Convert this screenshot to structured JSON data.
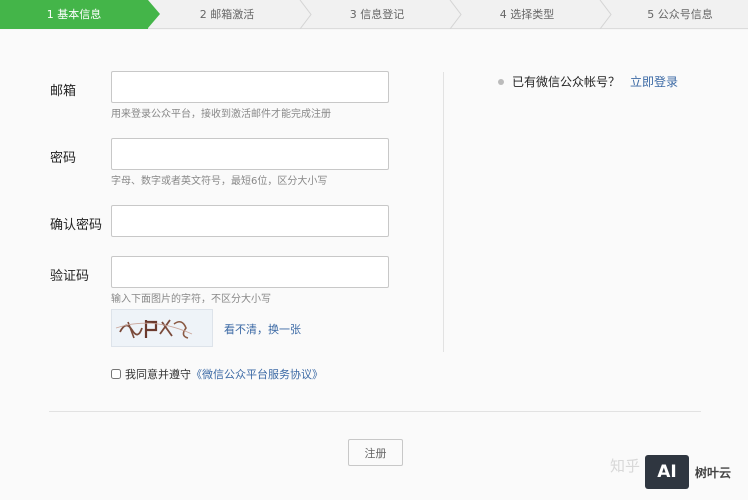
{
  "steps": [
    {
      "label": "1 基本信息",
      "active": true
    },
    {
      "label": "2 邮箱激活",
      "active": false
    },
    {
      "label": "3 信息登记",
      "active": false
    },
    {
      "label": "4 选择类型",
      "active": false
    },
    {
      "label": "5 公众号信息",
      "active": false
    }
  ],
  "form": {
    "email_label": "邮箱",
    "email_value": "",
    "email_hint": "用来登录公众平台，接收到激活邮件才能完成注册",
    "password_label": "密码",
    "password_value": "",
    "password_hint": "字母、数字或者英文符号，最短6位，区分大小写",
    "confirm_label": "确认密码",
    "confirm_value": "",
    "captcha_label": "验证码",
    "captcha_value": "",
    "captcha_hint": "输入下面图片的字符，不区分大小写",
    "captcha_refresh": "看不清，换一张",
    "agree_prefix": "我同意并遵守",
    "agree_link": "《微信公众平台服务协议》",
    "submit_label": "注册"
  },
  "side": {
    "question": "已有微信公众帐号？",
    "login_link": "立即登录"
  },
  "watermark": {
    "zhihu_text": "知乎",
    "logo_mark": "AI",
    "logo_text": "树叶云"
  },
  "colors": {
    "accent": "#44b549",
    "link": "#3c6aa5"
  }
}
